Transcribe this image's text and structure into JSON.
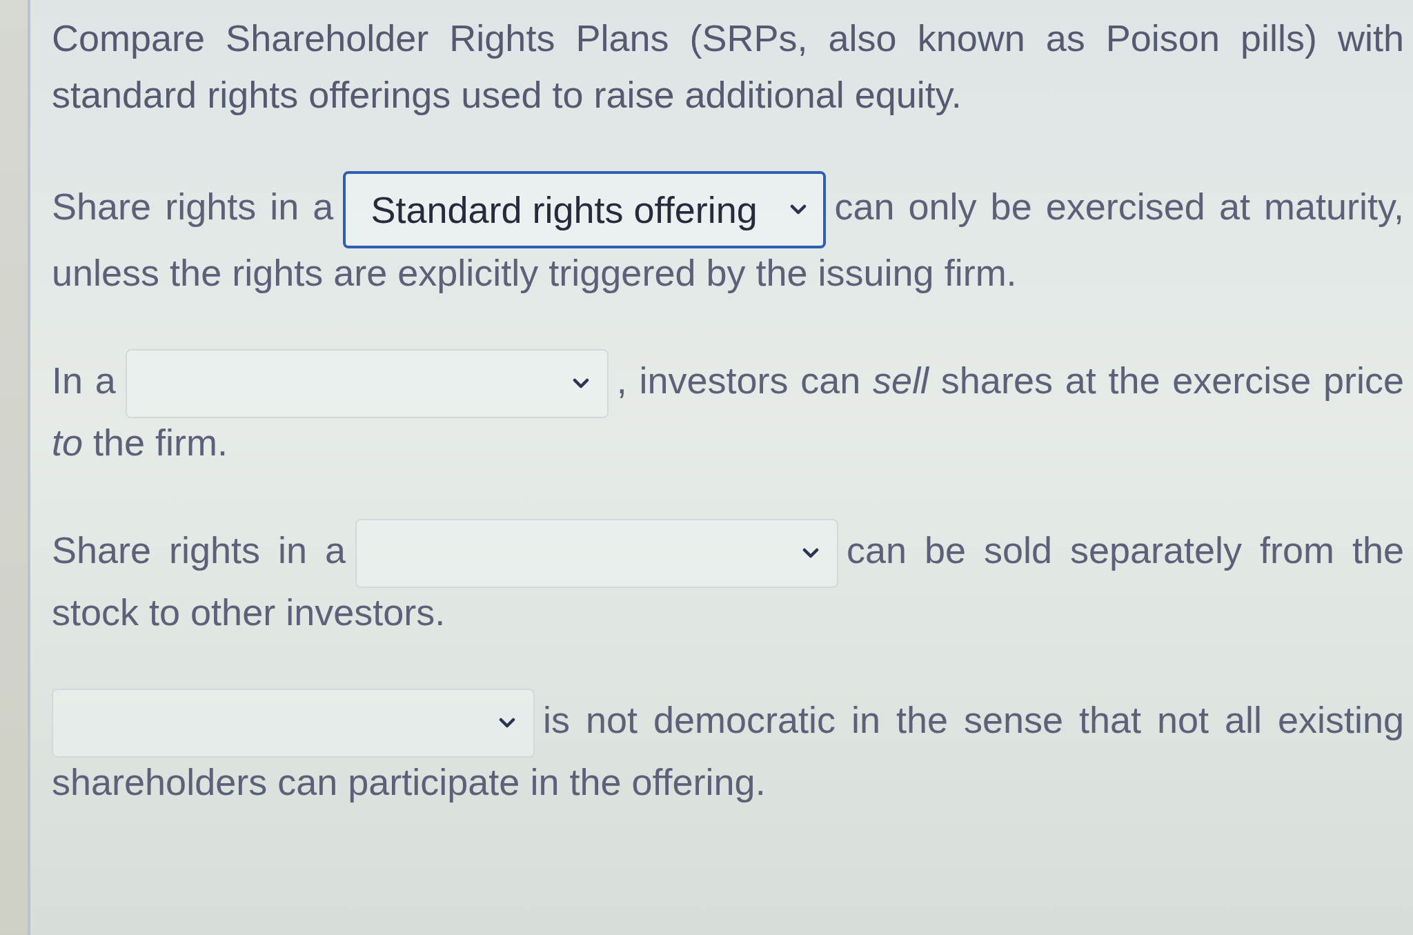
{
  "prompt": "Compare Shareholder Rights Plans (SRPs, also known as Poison pills) with standard rights offerings used to raise additional equity.",
  "questions": [
    {
      "before": "Share rights in a",
      "dropdown": {
        "value": "Standard rights offering",
        "focused": true
      },
      "after": "can only be exercised at maturity,",
      "continuation": "unless the rights are explicitly triggered by the issuing firm."
    },
    {
      "before": "In a",
      "dropdown": {
        "focused": false
      },
      "after": ", investors can *sell* shares at the exercise price",
      "continuation": "*to* the firm."
    },
    {
      "before": "Share rights in a",
      "dropdown": {
        "focused": false
      },
      "after": "can be sold separately from the",
      "continuation": "stock to other investors."
    },
    {
      "dropdown": {
        "focused": false
      },
      "after": "is not democratic in the sense that not all existing",
      "continuation": "shareholders can participate in the offering."
    }
  ]
}
